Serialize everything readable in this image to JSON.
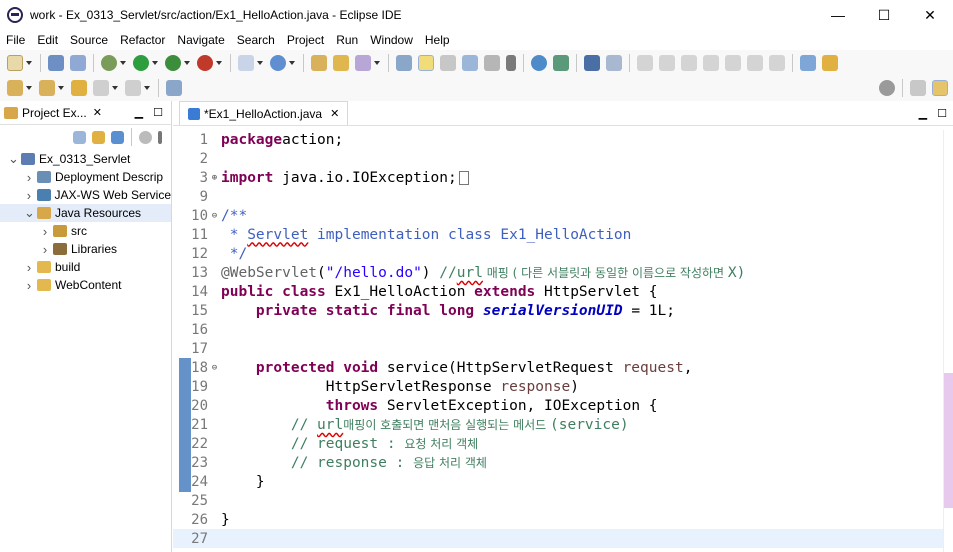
{
  "window": {
    "title": "work - Ex_0313_Servlet/src/action/Ex1_HelloAction.java - Eclipse IDE",
    "controls": {
      "minimize": "—",
      "maximize": "☐",
      "close": "✕"
    }
  },
  "menu": [
    "File",
    "Edit",
    "Source",
    "Refactor",
    "Navigate",
    "Search",
    "Project",
    "Run",
    "Window",
    "Help"
  ],
  "project_explorer": {
    "tab_label": "Project Ex...",
    "close_glyph": "✕",
    "tree": [
      {
        "label": "Ex_0313_Servlet",
        "twisty": "v",
        "depth": 0,
        "icon_color": "#5b7db1"
      },
      {
        "label": "Deployment Descrip",
        "twisty": ">",
        "depth": 1,
        "icon_color": "#6a8fb5"
      },
      {
        "label": "JAX-WS Web Service",
        "twisty": ">",
        "depth": 1,
        "icon_color": "#4a7fb0"
      },
      {
        "label": "Java Resources",
        "twisty": "v",
        "depth": 1,
        "icon_color": "#d8a74a",
        "selected": true
      },
      {
        "label": "src",
        "twisty": ">",
        "depth": 2,
        "icon_color": "#c89a3a"
      },
      {
        "label": "Libraries",
        "twisty": ">",
        "depth": 2,
        "icon_color": "#8a6d3b"
      },
      {
        "label": "build",
        "twisty": ">",
        "depth": 1,
        "icon_color": "#e3b84f"
      },
      {
        "label": "WebContent",
        "twisty": ">",
        "depth": 1,
        "icon_color": "#e3b84f"
      }
    ]
  },
  "editor": {
    "tab_label": "*Ex1_HelloAction.java",
    "close_glyph": "✕",
    "lines": [
      {
        "n": "1",
        "parts": [
          [
            "kw",
            "package"
          ],
          [
            "",
            "action;"
          ]
        ]
      },
      {
        "n": "2",
        "parts": []
      },
      {
        "n": "3",
        "fold": "+",
        "parts": [
          [
            "kw",
            "import"
          ],
          [
            "",
            " java.io.IOException;"
          ]
        ],
        "folded": true
      },
      {
        "n": "9",
        "parts": []
      },
      {
        "n": "10",
        "fold": "-",
        "parts": [
          [
            "jd",
            "/**"
          ]
        ]
      },
      {
        "n": "11",
        "parts": [
          [
            "jd",
            " * "
          ],
          [
            "jd sq",
            "Servlet"
          ],
          [
            "jd",
            " implementation class Ex1_HelloAction"
          ]
        ]
      },
      {
        "n": "12",
        "parts": [
          [
            "jd",
            " */"
          ]
        ]
      },
      {
        "n": "13",
        "parts": [
          [
            "ann",
            "@WebServlet"
          ],
          [
            "",
            "("
          ],
          [
            "str",
            "\"/hello.do\""
          ],
          [
            "",
            ") "
          ],
          [
            "cm",
            "//"
          ],
          [
            "cm sq",
            "url"
          ],
          [
            "cm ko",
            " 매핑 ( 다른 서블릿과 동일한 이름으로 작성하면 "
          ],
          [
            "cm",
            "X)"
          ]
        ]
      },
      {
        "n": "14",
        "parts": [
          [
            "kw",
            "public class"
          ],
          [
            "",
            " Ex1_HelloAction "
          ],
          [
            "kw",
            "extends"
          ],
          [
            "",
            " HttpServlet {"
          ]
        ]
      },
      {
        "n": "15",
        "parts": [
          [
            "",
            "    "
          ],
          [
            "kw",
            "private static final long"
          ],
          [
            "",
            " "
          ],
          [
            "fld",
            "serialVersionUID"
          ],
          [
            "",
            " = 1L;"
          ]
        ]
      },
      {
        "n": "16",
        "parts": []
      },
      {
        "n": "17",
        "parts": []
      },
      {
        "n": "18",
        "fold": "-",
        "parts": [
          [
            "",
            "    "
          ],
          [
            "kw",
            "protected void"
          ],
          [
            "",
            " service(HttpServletRequest "
          ],
          [
            "prm",
            "request"
          ],
          [
            "",
            ","
          ]
        ]
      },
      {
        "n": "19",
        "parts": [
          [
            "",
            "            HttpServletResponse "
          ],
          [
            "prm",
            "response"
          ],
          [
            "",
            ")"
          ]
        ]
      },
      {
        "n": "20",
        "parts": [
          [
            "",
            "            "
          ],
          [
            "kw",
            "throws"
          ],
          [
            "",
            " ServletException, IOException {"
          ]
        ]
      },
      {
        "n": "21",
        "parts": [
          [
            "",
            "        "
          ],
          [
            "cm",
            "// "
          ],
          [
            "cm sq",
            "url"
          ],
          [
            "cm ko",
            "매핑이 호출되면 맨처음 실행되는 메서드 "
          ],
          [
            "cm",
            "(service)"
          ]
        ]
      },
      {
        "n": "22",
        "parts": [
          [
            "",
            "        "
          ],
          [
            "cm",
            "// request : "
          ],
          [
            "cm ko",
            "요청 처리 객체"
          ]
        ]
      },
      {
        "n": "23",
        "parts": [
          [
            "",
            "        "
          ],
          [
            "cm",
            "// response : "
          ],
          [
            "cm ko",
            "응답 처리 객체"
          ]
        ]
      },
      {
        "n": "24",
        "parts": [
          [
            "",
            "    }"
          ]
        ]
      },
      {
        "n": "25",
        "parts": []
      },
      {
        "n": "26",
        "parts": [
          [
            "",
            "}"
          ]
        ]
      },
      {
        "n": "27",
        "parts": [],
        "current": true
      }
    ]
  },
  "colors": {
    "keyword": "#7f0055",
    "comment": "#3f7f5f",
    "javadoc": "#3f5fbf",
    "string": "#2a00ff",
    "annotation": "#646464",
    "field": "#0000c0",
    "current_line": "#e8f2fe"
  }
}
